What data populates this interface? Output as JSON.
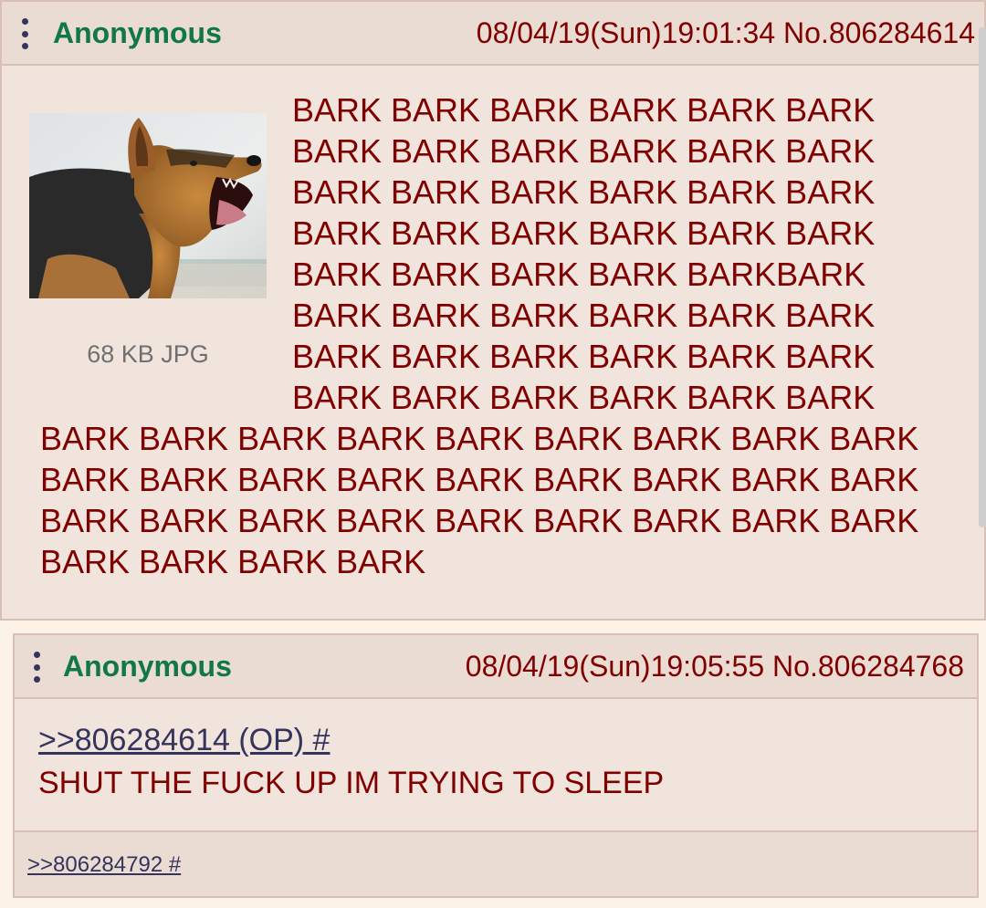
{
  "posts": [
    {
      "name": "Anonymous",
      "datetime": "08/04/19(Sun)19:01:34",
      "number": "No.806284614",
      "file_info": "68 KB JPG",
      "thumbnail_icon": "barking-dog-photo",
      "body_lines_beside_image": [
        "BARK BARK BARK BARK BARK BARK",
        "BARK BARK BARK BARK BARK BARK",
        "BARK BARK BARK BARK BARK BARK",
        "BARK BARK BARK BARK BARK BARK",
        "BARK BARK BARK BARK BARKBARK",
        "BARK BARK BARK BARK BARK BARK",
        "BARK BARK BARK BARK BARK BARK",
        "BARK BARK BARK BARK BARK BARK"
      ],
      "body_lines_below_image": [
        "BARK BARK BARK BARK BARK BARK BARK BARK BARK",
        "BARK BARK BARK BARK BARK BARK BARK BARK BARK",
        "BARK BARK BARK BARK BARK BARK BARK BARK BARK",
        "BARK BARK BARK BARK"
      ]
    },
    {
      "name": "Anonymous",
      "datetime": "08/04/19(Sun)19:05:55",
      "number": "No.806284768",
      "quote_link": ">>806284614 (OP) #",
      "text": "SHUT THE FUCK UP IM TRYING TO SLEEP",
      "backlink": ">>806284792 #"
    }
  ],
  "colors": {
    "background": "#fdf2e6",
    "post_background": "#f1e4dc",
    "post_header": "#eadbd3",
    "name": "#117743",
    "text": "#800000",
    "link": "#34345c",
    "file_info": "#707070"
  }
}
